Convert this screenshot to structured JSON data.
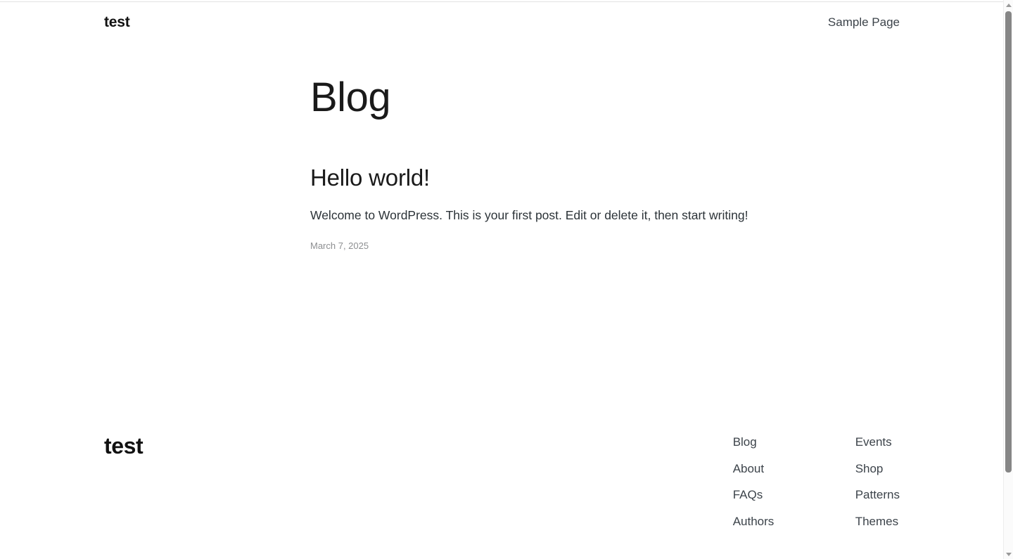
{
  "header": {
    "site_title": "test",
    "nav": [
      {
        "label": "Sample Page"
      }
    ]
  },
  "main": {
    "archive_title": "Blog",
    "posts": [
      {
        "title": "Hello world!",
        "excerpt": "Welcome to WordPress. This is your first post. Edit or delete it, then start writing!",
        "date": "March 7, 2025"
      }
    ]
  },
  "footer": {
    "brand": "test",
    "columns": [
      {
        "links": [
          {
            "label": "Blog"
          },
          {
            "label": "About"
          },
          {
            "label": "FAQs"
          },
          {
            "label": "Authors"
          }
        ]
      },
      {
        "links": [
          {
            "label": "Events"
          },
          {
            "label": "Shop"
          },
          {
            "label": "Patterns"
          },
          {
            "label": "Themes"
          }
        ]
      }
    ]
  },
  "scrollbar": {
    "up_arrow": "scroll-up-arrow",
    "down_arrow": "scroll-down-arrow"
  },
  "colors": {
    "background": "#ffffff",
    "text": "#1a1a1a",
    "muted_text": "#3c434a",
    "date_text": "#8d8f91",
    "scrollbar_thumb": "#868686"
  }
}
